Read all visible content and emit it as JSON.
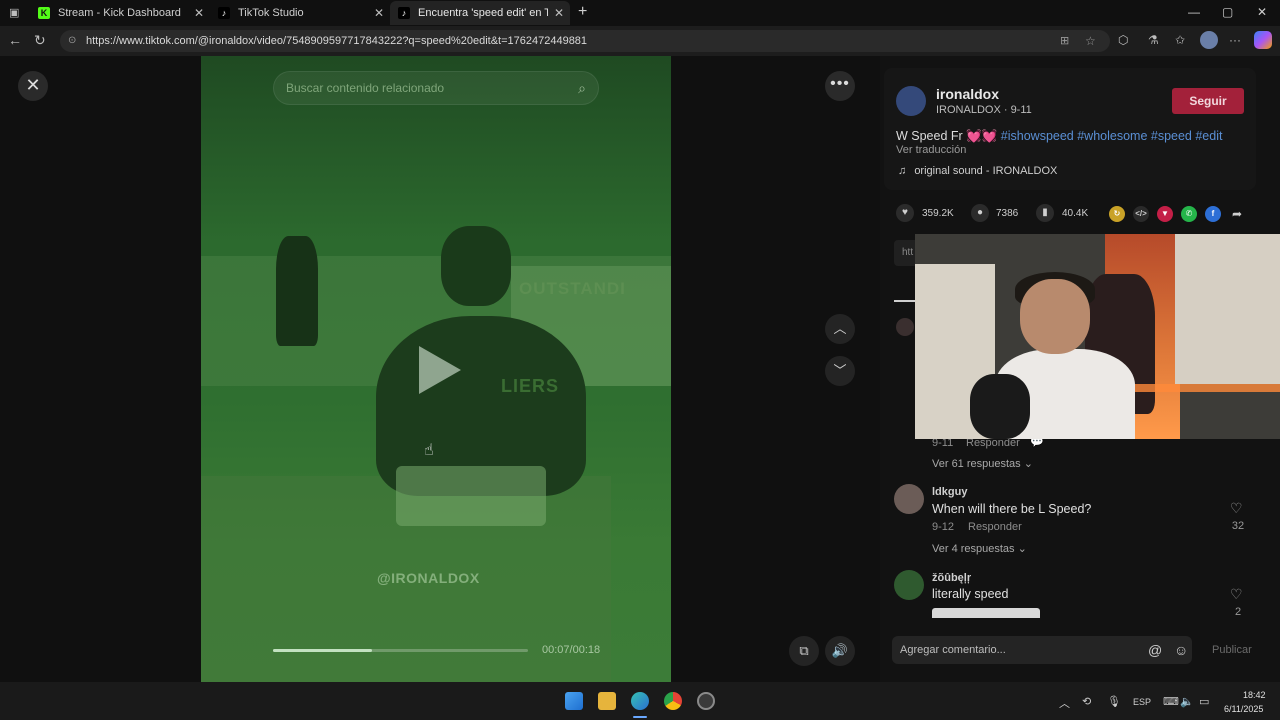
{
  "browser": {
    "tabs": [
      {
        "title": "Stream - Kick Dashboard",
        "icon": "kick-icon",
        "active": false
      },
      {
        "title": "TikTok Studio",
        "icon": "tiktok-icon",
        "active": false
      },
      {
        "title": "Encuentra 'speed edit' en TikTok |",
        "icon": "tiktok-icon",
        "active": true
      }
    ],
    "new_tab_label": "+",
    "url": "https://www.tiktok.com/@ironaldox/video/7548909597717843222?q=speed%20edit&t=1762472449881",
    "window_controls": [
      "—",
      "▢",
      "✕"
    ]
  },
  "video": {
    "search_placeholder": "Buscar contenido relacionado",
    "watermark": "@IRONALDOX",
    "sign_text": "OUTSTANDI",
    "shirt_text": "LIERS",
    "time": "00:07/00:18",
    "progress": 0.39
  },
  "author": {
    "name": "ironaldox",
    "subtitle": "IRONALDOX · 9-11",
    "follow_label": "Seguir"
  },
  "post": {
    "caption_plain": "W Speed Fr 💓💓",
    "caption_tags": "#ishowspeed #wholesome #speed #edit",
    "translate_label": "Ver traducción",
    "sound": "original sound - IRONALDOX"
  },
  "actions": {
    "likes": "359.2K",
    "comments": "7386",
    "saves": "40.4K"
  },
  "link_chip": "htt",
  "comments": [
    {
      "meta_date": "9-11",
      "reply_label": "Responder",
      "view_replies": "Ver 61 respuestas"
    },
    {
      "user": "ldkguy",
      "text": "When will there be L Speed?",
      "meta_date": "9-12",
      "reply_label": "Responder",
      "likes": "32",
      "view_replies": "Ver 4 respuestas"
    },
    {
      "user": "žõûbęļŗ",
      "text": "literally speed",
      "likes": "2"
    }
  ],
  "comment_input": {
    "placeholder": "Agregar comentario...",
    "publish_label": "Publicar"
  },
  "taskbar": {
    "language": "ESP",
    "time": "18:42",
    "date": "6/11/2025"
  },
  "colors": {
    "follow": "#a3213a",
    "hashtag": "#5a8fd4",
    "video_tint": "#2f6f30"
  }
}
